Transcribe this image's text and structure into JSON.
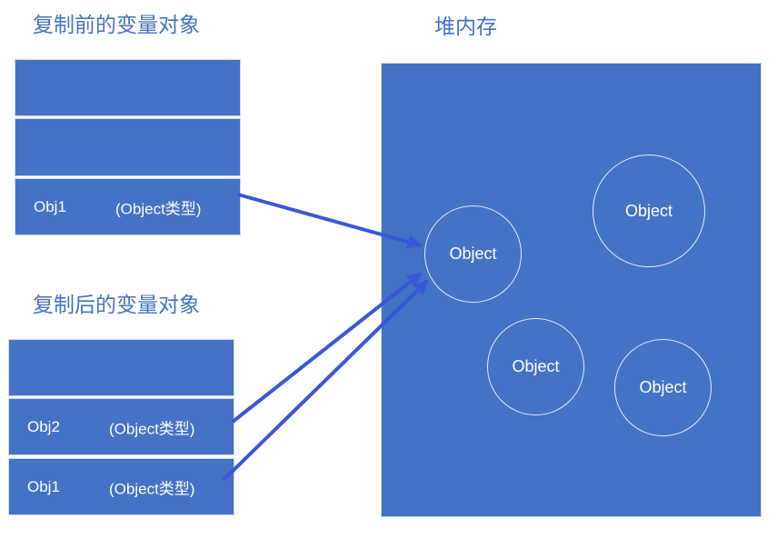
{
  "before": {
    "title": "复制前的变量对象",
    "rows": [
      {
        "name": "",
        "type": ""
      },
      {
        "name": "",
        "type": ""
      },
      {
        "name": "Obj1",
        "type": "(Object类型)"
      }
    ]
  },
  "after": {
    "title": "复制后的变量对象",
    "rows": [
      {
        "name": "",
        "type": ""
      },
      {
        "name": "Obj2",
        "type": "(Object类型)"
      },
      {
        "name": "Obj1",
        "type": "(Object类型)"
      }
    ]
  },
  "heap": {
    "title": "堆内存",
    "objects": [
      "Object",
      "Object",
      "Object",
      "Object"
    ]
  },
  "colors": {
    "fill": "#4472c4",
    "title": "#4472c4",
    "arrow": "#3a57d8"
  }
}
